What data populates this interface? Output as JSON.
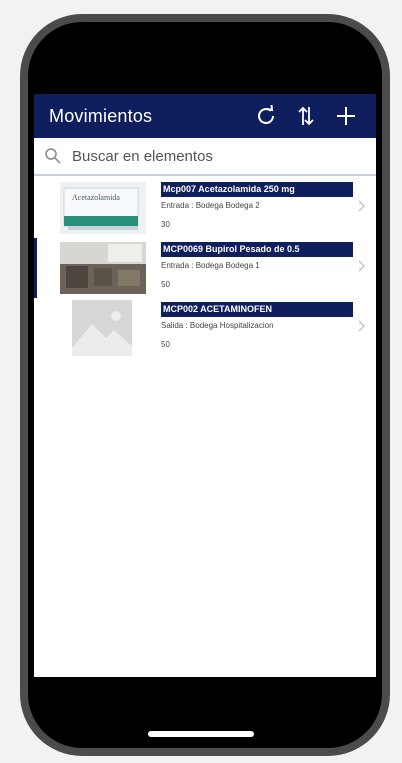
{
  "app": {
    "title": "Movimientos"
  },
  "search": {
    "placeholder": "Buscar en elementos"
  },
  "items": [
    {
      "name": "Mcp007 Acetazolamida 250 mg",
      "detail": "Entrada : Bodega Bodega 2",
      "qty": "30",
      "image": "acetazolamida-box"
    },
    {
      "name": "MCP0069 Bupirol Pesado de 0.5",
      "detail": "Entrada : Bodega Bodega 1",
      "qty": "50",
      "image": "room-photo"
    },
    {
      "name": "MCP002 ACETAMINOFEN",
      "detail": "Salida : Bodega Hospitalizacion",
      "qty": "50",
      "image": "placeholder-image"
    }
  ],
  "thumb_texts": {
    "box_label": "Acetazolamida"
  },
  "colors": {
    "header": "#0f1e5c",
    "accent": "#0f1e5c"
  }
}
